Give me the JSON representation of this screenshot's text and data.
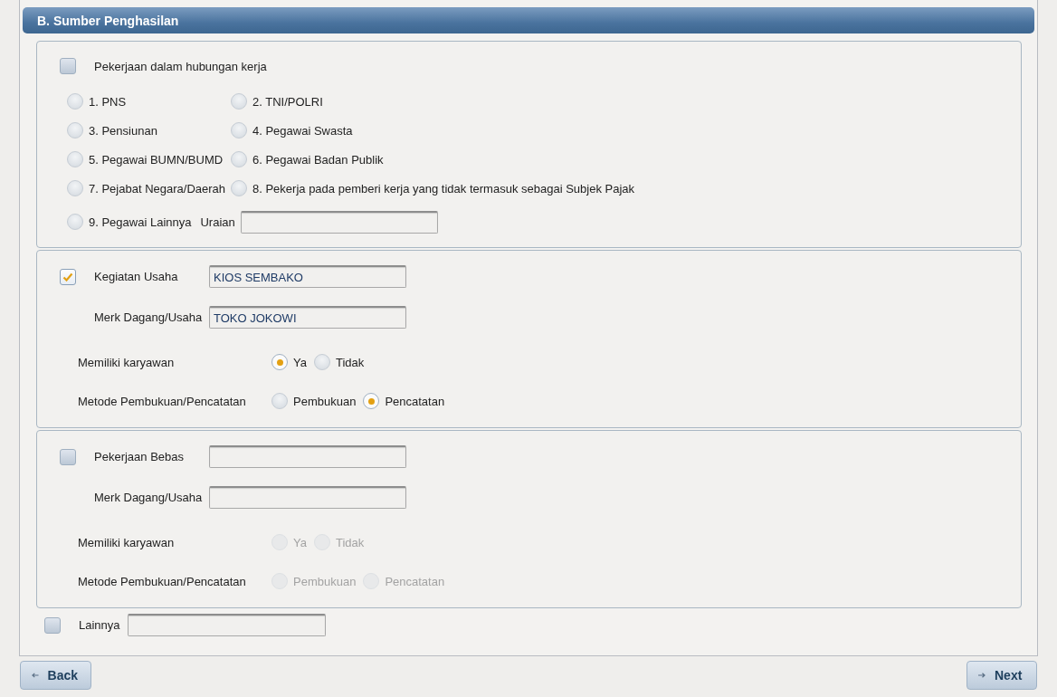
{
  "header": {
    "title": "B. Sumber Penghasilan"
  },
  "employment": {
    "label": "Pekerjaan dalam hubungan kerja",
    "checked": false,
    "uraian_label": "Uraian",
    "options": [
      {
        "label": "1. PNS",
        "selected": false
      },
      {
        "label": "2. TNI/POLRI",
        "selected": false
      },
      {
        "label": "3. Pensiunan",
        "selected": false
      },
      {
        "label": "4. Pegawai Swasta",
        "selected": false
      },
      {
        "label": "5. Pegawai BUMN/BUMD",
        "selected": false
      },
      {
        "label": "6. Pegawai Badan Publik",
        "selected": false
      },
      {
        "label": "7. Pejabat Negara/Daerah",
        "selected": false
      },
      {
        "label": "8. Pekerja pada pemberi kerja yang tidak termasuk sebagai Subjek Pajak",
        "selected": false
      },
      {
        "label": "9. Pegawai Lainnya",
        "selected": false
      }
    ]
  },
  "business_sections": [
    {
      "label": "Kegiatan Usaha",
      "checked": true,
      "value": "KIOS SEMBAKO",
      "brand_label": "Merk Dagang/Usaha",
      "brand_value": "TOKO JOKOWI",
      "disabled": false,
      "employees": {
        "label": "Memiliki karyawan",
        "options": [
          {
            "label": "Ya",
            "selected": true
          },
          {
            "label": "Tidak",
            "selected": false
          }
        ]
      },
      "method": {
        "label": "Metode Pembukuan/Pencatatan",
        "options": [
          {
            "label": "Pembukuan",
            "selected": false
          },
          {
            "label": "Pencatatan",
            "selected": true
          }
        ]
      }
    },
    {
      "label": "Pekerjaan Bebas",
      "checked": false,
      "brand_label": "Merk Dagang/Usaha",
      "disabled": true,
      "employees": {
        "label": "Memiliki karyawan",
        "options": [
          {
            "label": "Ya",
            "selected": false
          },
          {
            "label": "Tidak",
            "selected": false
          }
        ]
      },
      "method": {
        "label": "Metode Pembukuan/Pencatatan",
        "options": [
          {
            "label": "Pembukuan",
            "selected": false
          },
          {
            "label": "Pencatatan",
            "selected": false
          }
        ]
      }
    }
  ],
  "other": {
    "label": "Lainnya",
    "checked": false
  },
  "buttons": {
    "back": "Back",
    "next": "Next"
  }
}
